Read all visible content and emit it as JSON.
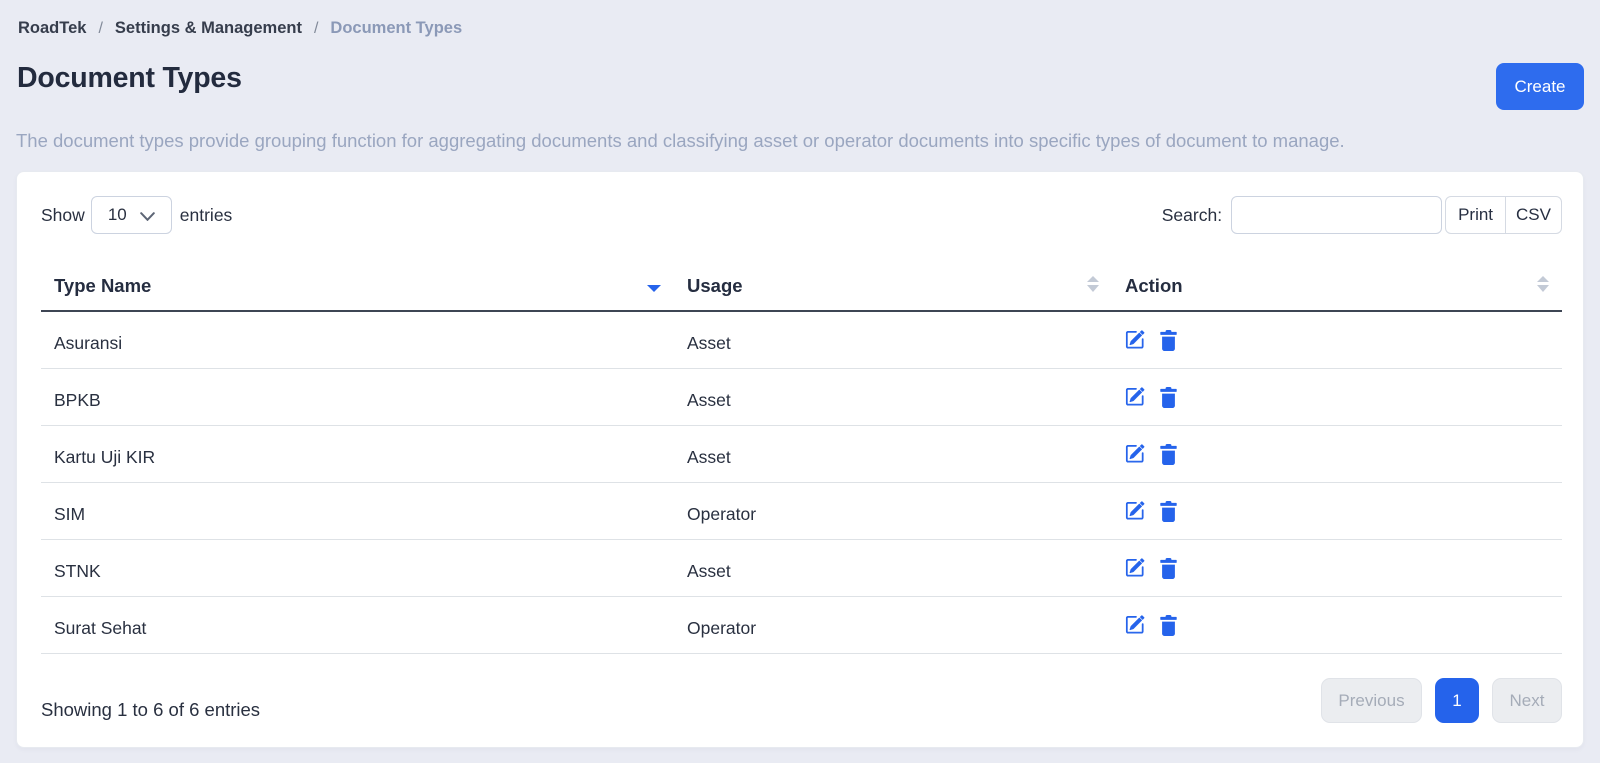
{
  "breadcrumb": {
    "items": [
      {
        "label": "RoadTek",
        "active": false
      },
      {
        "label": "Settings & Management",
        "active": false
      },
      {
        "label": "Document Types",
        "active": true
      }
    ],
    "separator": "/"
  },
  "header": {
    "title": "Document Types",
    "create_button": "Create",
    "description": "The document types provide grouping function for aggregating documents and classifying asset or operator documents into specific types of document to manage."
  },
  "controls": {
    "show_label": "Show",
    "entries_select_value": "10",
    "entries_label": "entries",
    "search_label": "Search:",
    "search_value": "",
    "print_button": "Print",
    "csv_button": "CSV"
  },
  "table": {
    "columns": [
      {
        "label": "Type Name",
        "sort": "desc"
      },
      {
        "label": "Usage",
        "sort": "none"
      },
      {
        "label": "Action",
        "sort": "none"
      }
    ],
    "rows": [
      {
        "type_name": "Asuransi",
        "usage": "Asset"
      },
      {
        "type_name": "BPKB",
        "usage": "Asset"
      },
      {
        "type_name": "Kartu Uji KIR",
        "usage": "Asset"
      },
      {
        "type_name": "SIM",
        "usage": "Operator"
      },
      {
        "type_name": "STNK",
        "usage": "Asset"
      },
      {
        "type_name": "Surat Sehat",
        "usage": "Operator"
      }
    ],
    "row_actions": [
      "edit",
      "delete"
    ]
  },
  "footer": {
    "showing_info": "Showing 1 to 6 of 6 entries",
    "pagination": {
      "previous_label": "Previous",
      "current_page": "1",
      "next_label": "Next"
    }
  },
  "colors": {
    "accent": "#2563eb",
    "create_button": "#2f6bed",
    "page_background": "#e9ecf4",
    "card_background": "#ffffff"
  }
}
